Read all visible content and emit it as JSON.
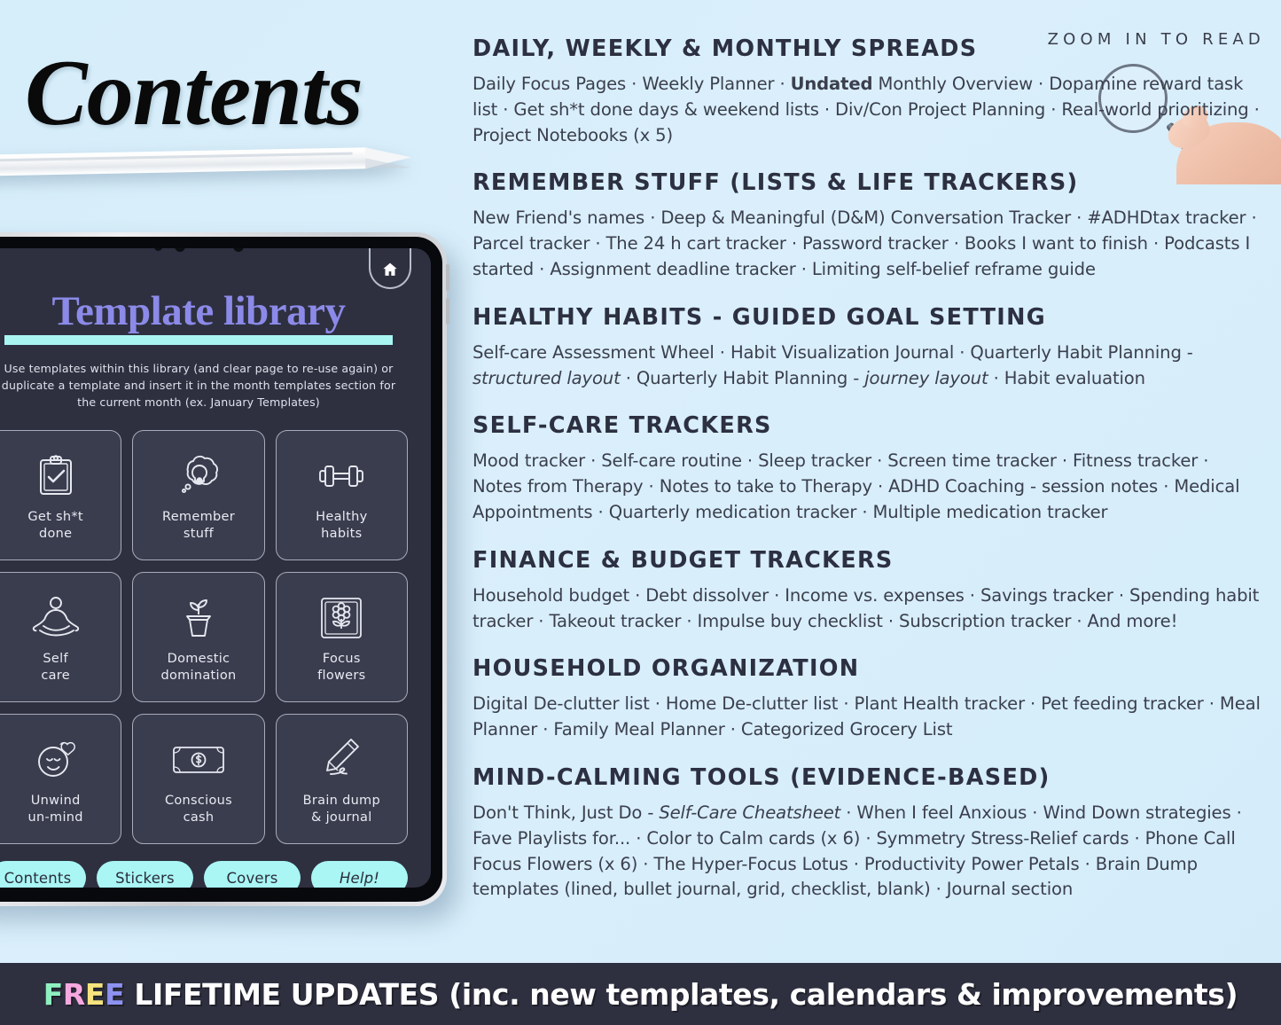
{
  "page": {
    "background_color": "#d9eefb",
    "accent_cyan": "#a9f6f4",
    "accent_purple": "#8c8ae8",
    "dark_navy": "#2e3040"
  },
  "left": {
    "title": "Contents",
    "stylus_icon": "apple-pencil-stylus"
  },
  "zoom_hint": {
    "label": "ZOOM IN TO READ",
    "magnifier_icon": "magnifying-glass-icon",
    "hand_icon": "hand-holding-icon"
  },
  "tablet": {
    "home_icon": "home-icon",
    "library_title": "Template library",
    "library_sub": "Use templates within this library (and clear page to re-use again) or duplicate a template and insert it in the month templates section for the current month (ex. January Templates)",
    "cards": [
      {
        "label": "Get sh*t\ndone",
        "icon": "clipboard-check-icon"
      },
      {
        "label": "Remember\nstuff",
        "icon": "lightbulb-thought-icon"
      },
      {
        "label": "Healthy\nhabits",
        "icon": "dumbbell-icon"
      },
      {
        "label": "Self\ncare",
        "icon": "meditation-lotus-icon"
      },
      {
        "label": "Domestic\ndomination",
        "icon": "potted-plant-icon"
      },
      {
        "label": "Focus\nflowers",
        "icon": "framed-flower-icon"
      },
      {
        "label": "Unwind\nun-mind",
        "icon": "calm-face-heart-icon"
      },
      {
        "label": "Conscious\ncash",
        "icon": "banknote-dollar-icon"
      },
      {
        "label": "Brain dump\n& journal",
        "icon": "pencil-writing-icon"
      }
    ],
    "nav_buttons": [
      {
        "label": "Contents",
        "italic": false
      },
      {
        "label": "Stickers",
        "italic": false
      },
      {
        "label": "Covers",
        "italic": false
      },
      {
        "label": "Help!",
        "italic": true
      }
    ]
  },
  "sections": [
    {
      "heading": "Daily, Weekly & Monthly Spreads",
      "body_html": "Daily Focus Pages · Weekly Planner · <b>Undated</b> Monthly Overview · Dopamine reward task list · Get sh*t done days &amp; weekend lists · Div/Con Project Planning · Real-world prioritizing · Project Notebooks (x 5)"
    },
    {
      "heading": "Remember stuff (Lists & Life trackers)",
      "body_html": "New Friend's names · Deep &amp; Meaningful (D&amp;M) Conversation Tracker · #ADHDtax tracker · Parcel tracker · The  24 h cart tracker · Password tracker · Books I want to finish · Podcasts I started · Assignment deadline tracker · Limiting self-belief reframe guide"
    },
    {
      "heading": "Healthy habits - guided goal setting",
      "body_html": "Self-care Assessment Wheel · Habit Visualization Journal · Quarterly Habit Planning - <i>structured layout</i> · Quarterly Habit Planning - <i>journey layout</i> · Habit evaluation"
    },
    {
      "heading": "Self-care trackers",
      "body_html": "Mood tracker · Self-care routine · Sleep tracker · Screen time tracker · Fitness tracker · Notes from Therapy · Notes to take to Therapy ·  ADHD Coaching - session notes · Medical Appointments · Quarterly medication tracker · Multiple medication tracker"
    },
    {
      "heading": "Finance & budget trackers",
      "body_html": "Household budget · Debt dissolver · Income vs. expenses · Savings tracker · Spending habit tracker · Takeout tracker · Impulse buy checklist · Subscription tracker · And more!"
    },
    {
      "heading": "Household organization",
      "body_html": "Digital De-clutter list · Home De-clutter list · Plant Health tracker ·  Pet feeding tracker · Meal Planner · Family Meal Planner · Categorized Grocery List"
    },
    {
      "heading": "Mind-calming tools (evidence-based)",
      "body_html": "Don't Think, Just Do - <i>Self-Care Cheatsheet</i> · When I feel Anxious · Wind Down strategies · Fave Playlists for... · Color to Calm cards (x 6) · Symmetry Stress-Relief cards · Phone Call Focus Flowers (x 6) · The Hyper-Focus Lotus · Productivity Power Petals · Brain Dump templates (lined, bullet journal, grid, checklist, blank) · Journal section"
    }
  ],
  "banner": {
    "segments": [
      {
        "text": "F",
        "color": "#8ef0c0"
      },
      {
        "text": "R",
        "color": "#f7a8e0"
      },
      {
        "text": "E",
        "color": "#f5e47e"
      },
      {
        "text": "E",
        "color": "#8d92f2"
      },
      {
        "text": " LIFETIME UPDATES (inc. new templates, calendars & improvements)",
        "color": "#ffffff"
      }
    ],
    "full_text": "FREE LIFETIME UPDATES (inc. new templates, calendars & improvements)"
  }
}
